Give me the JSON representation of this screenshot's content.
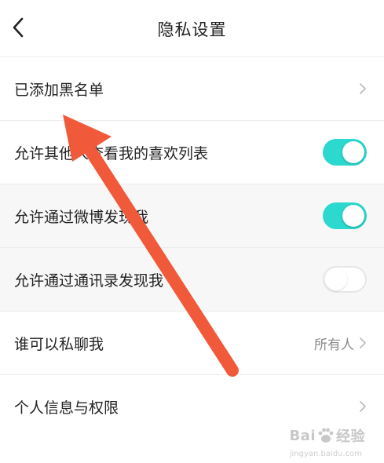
{
  "header": {
    "title": "隐私设置",
    "back_icon": "chevron-left-icon"
  },
  "rows": [
    {
      "label": "已添加黑名单",
      "type": "link"
    },
    {
      "label": "允许其他人查看我的喜欢列表",
      "type": "toggle",
      "state": "on"
    },
    {
      "label": "允许通过微博发现我",
      "type": "toggle",
      "state": "on"
    },
    {
      "label": "允许通过通讯录发现我",
      "type": "toggle",
      "state": "off"
    },
    {
      "label": "谁可以私聊我",
      "type": "link",
      "value": "所有人"
    },
    {
      "label": "个人信息与权限",
      "type": "link"
    }
  ],
  "colors": {
    "toggle_on": "#2bd9cf",
    "annotation_arrow": "#f05a3a"
  },
  "watermark": {
    "text_left": "Bai",
    "text_right": "经验",
    "sub": "jingyan.baidu.com"
  }
}
